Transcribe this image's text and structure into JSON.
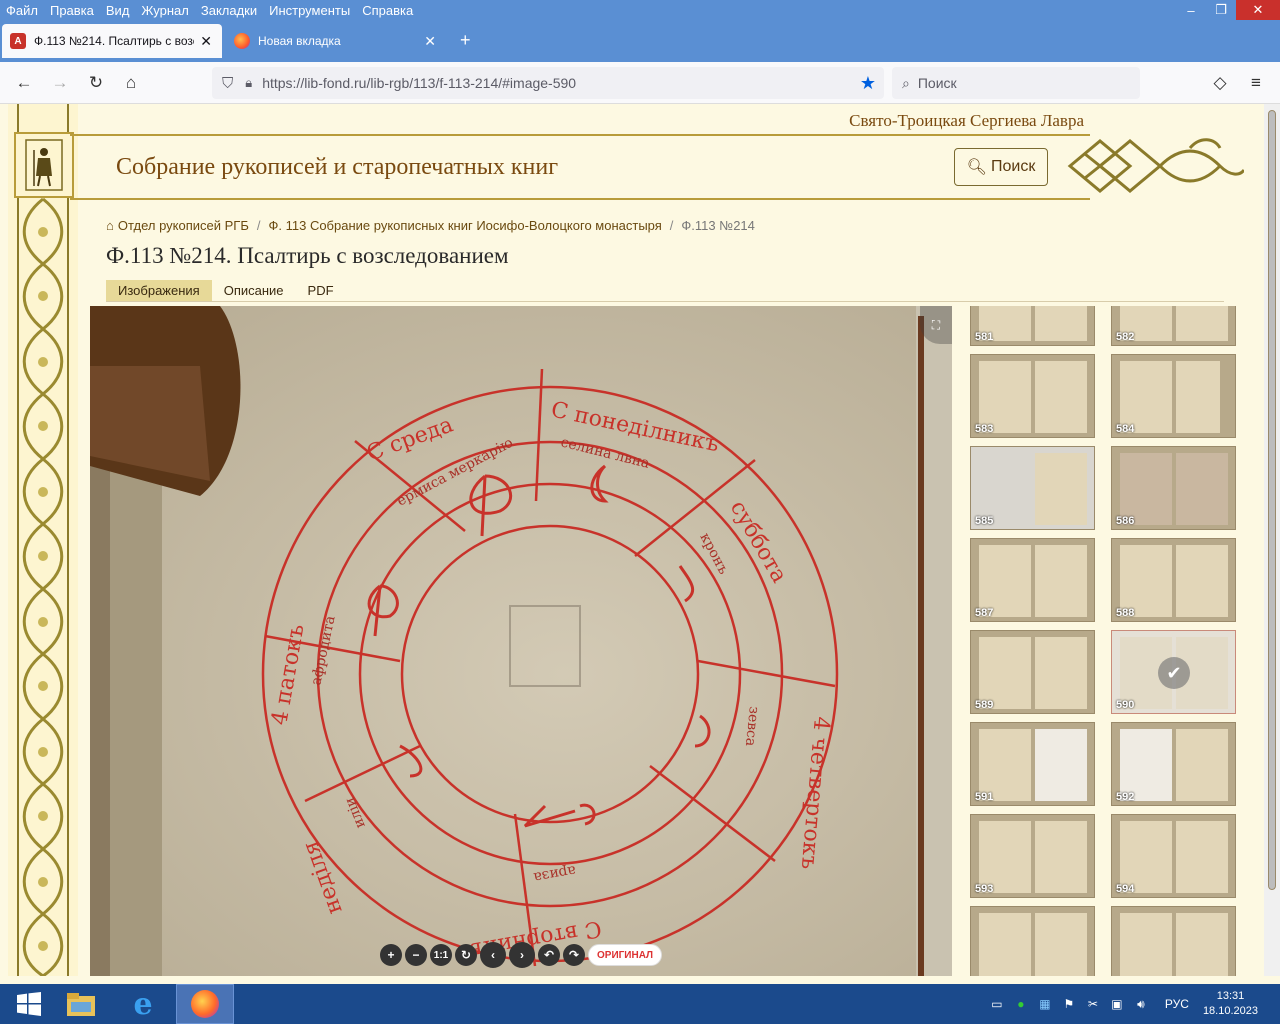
{
  "menu": [
    "Файл",
    "Правка",
    "Вид",
    "Журнал",
    "Закладки",
    "Инструменты",
    "Справка"
  ],
  "window_controls": {
    "minimize": "–",
    "restore": "❐",
    "close": "✕"
  },
  "tabs": [
    {
      "title": "Ф.113 №214. Псалтирь с возследованием",
      "icon": "site-favicon",
      "close": "✕"
    },
    {
      "title": "Новая вкладка",
      "icon": "firefox-icon",
      "close": "✕"
    }
  ],
  "new_tab": "+",
  "nav": {
    "back": "←",
    "forward": "→",
    "reload": "↻",
    "home": "⌂",
    "url": "https://lib-fond.ru/lib-rgb/113/f-113-214/#image-590",
    "search_placeholder": "Поиск",
    "pocket": "◇",
    "menu": "≡"
  },
  "site": {
    "lavra": "Свято-Троицкая Сергиева Лавра",
    "title": "Собрание рукописей и старопечатных книг",
    "search_button": "Поиск"
  },
  "breadcrumb": {
    "home": "Отдел рукописей РГБ",
    "fond": "Ф. 113 Собрание рукописных книг Иосифо-Волоцкого монастыря",
    "current": "Ф.113 №214",
    "sep": "/"
  },
  "document": {
    "title": "Ф.113 №214. Псалтирь с возследованием",
    "tabs": [
      "Изображения",
      "Описание",
      "PDF"
    ],
    "active_tab": "Изображения"
  },
  "viewer": {
    "controls": [
      "+",
      "−",
      "1:1",
      "↻",
      "‹",
      "›",
      "↶",
      "↷"
    ],
    "original_label": "ОРИГИНАЛ"
  },
  "thumbnails": [
    {
      "num": "581"
    },
    {
      "num": "582"
    },
    {
      "num": "583"
    },
    {
      "num": "584"
    },
    {
      "num": "585"
    },
    {
      "num": "586"
    },
    {
      "num": "587"
    },
    {
      "num": "588"
    },
    {
      "num": "589"
    },
    {
      "num": "590",
      "selected": true
    },
    {
      "num": "591"
    },
    {
      "num": "592"
    },
    {
      "num": "593"
    },
    {
      "num": "594"
    },
    {
      "num": ""
    },
    {
      "num": ""
    }
  ],
  "taskbar": {
    "language": "РУС",
    "time": "13:31",
    "date": "18.10.2023"
  },
  "colors": {
    "titlebar": "#5a8fd3",
    "page_bg": "#fdf9e2",
    "accent_gold": "#b89c3a",
    "ink_red": "#c8322a",
    "taskbar": "#1b4a8c"
  }
}
